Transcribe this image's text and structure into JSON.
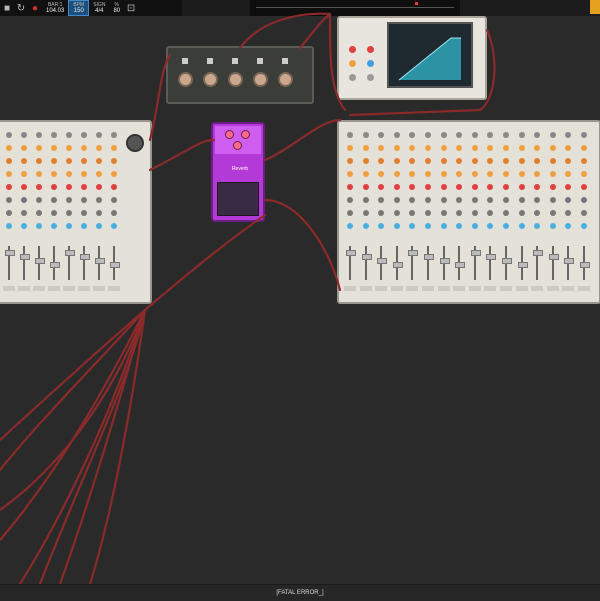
{
  "transport": {
    "bars_label": "BAR:1",
    "bars_value": "104.03",
    "bpm_label": "BPM",
    "bpm_value": "150",
    "sign_label": "SIGN",
    "sign_value": "4/4",
    "percent_label": "%",
    "percent_value": "80"
  },
  "status": {
    "message": "[FATAL ERROR_]"
  },
  "devices": {
    "left_mixer": {
      "channels": 8
    },
    "right_mixer": {
      "channels": 16
    },
    "hydra": {
      "knobs": 5
    },
    "pedal": {
      "name": "Reverb"
    },
    "vocoder": {}
  },
  "colors": {
    "cable": "#8a2a2a",
    "pedal": "#b43ad8",
    "accent_blue": "#3b8cd0",
    "screen_fill": "#2fa6b8"
  }
}
